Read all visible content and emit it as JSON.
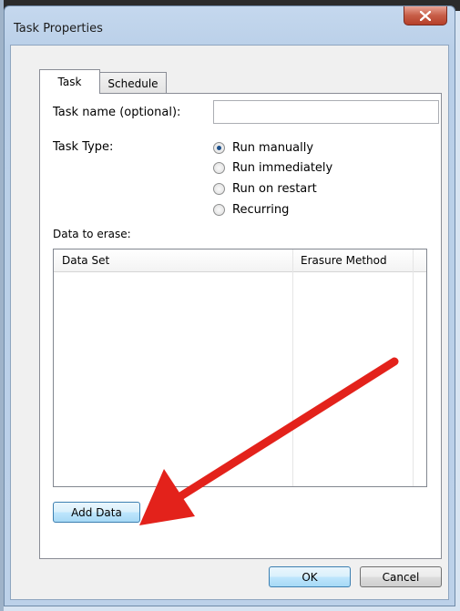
{
  "window": {
    "title": "Task Properties"
  },
  "tabs": [
    {
      "label": "Task"
    },
    {
      "label": "Schedule"
    }
  ],
  "task": {
    "name_label": "Task name (optional):",
    "name_value": "",
    "type_label": "Task Type:",
    "type_options": [
      {
        "label": "Run manually",
        "selected": true
      },
      {
        "label": "Run immediately",
        "selected": false
      },
      {
        "label": "Run on restart",
        "selected": false
      },
      {
        "label": "Recurring",
        "selected": false
      }
    ],
    "data_label": "Data to erase:",
    "columns": [
      "Data Set",
      "Erasure Method"
    ],
    "rows": [],
    "add_data_label": "Add Data"
  },
  "buttons": {
    "ok": "OK",
    "cancel": "Cancel"
  },
  "colors": {
    "annotation_arrow": "#e3221b",
    "close_button": "#c75d47"
  },
  "icons": {
    "close": "close-x-icon",
    "arrow": "red-annotation-arrow"
  }
}
